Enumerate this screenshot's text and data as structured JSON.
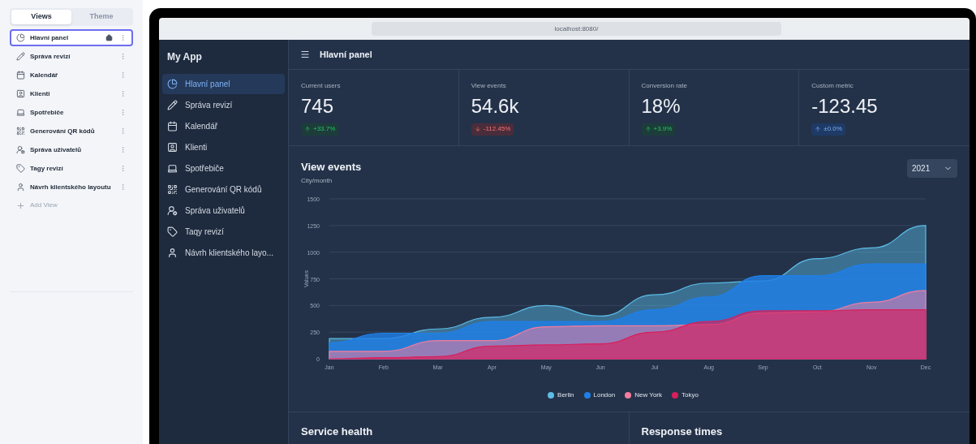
{
  "editor_panel": {
    "tabs": [
      {
        "label": "Views",
        "selected": true
      },
      {
        "label": "Theme",
        "selected": false
      }
    ],
    "views": [
      {
        "label": "Hlavní panel",
        "selected": true,
        "home": true
      },
      {
        "label": "Správa revizí",
        "selected": false,
        "home": false
      },
      {
        "label": "Kalendář",
        "selected": false,
        "home": false
      },
      {
        "label": "Klienti",
        "selected": false,
        "home": false
      },
      {
        "label": "Spotřebiče",
        "selected": false,
        "home": false
      },
      {
        "label": "Generování QR kódů",
        "selected": false,
        "home": false
      },
      {
        "label": "Správa uživatelů",
        "selected": false,
        "home": false
      },
      {
        "label": "Tagy revizí",
        "selected": false,
        "home": false
      },
      {
        "label": "Návrh klientského layoutu",
        "selected": false,
        "home": false
      }
    ],
    "add_view": "Add View"
  },
  "browser": {
    "url": "localhost:8080/"
  },
  "app": {
    "title": "My App",
    "nav": [
      {
        "label": "Hlavní panel",
        "selected": true
      },
      {
        "label": "Správa revizí",
        "selected": false
      },
      {
        "label": "Kalendář",
        "selected": false
      },
      {
        "label": "Klienti",
        "selected": false
      },
      {
        "label": "Spotřebiče",
        "selected": false
      },
      {
        "label": "Generování QR kódů",
        "selected": false
      },
      {
        "label": "Správa uživatelů",
        "selected": false
      },
      {
        "label": "Taqy revizí",
        "selected": false
      },
      {
        "label": "Návrh klientského layo...",
        "selected": false
      }
    ],
    "header_title": "Hlavní panel",
    "metrics": [
      {
        "label": "Current users",
        "value": "745",
        "change": "+33.7%",
        "kind": "up"
      },
      {
        "label": "View events",
        "value": "54.6k",
        "change": "-112.45%",
        "kind": "down"
      },
      {
        "label": "Conversion rate",
        "value": "18%",
        "change": "+3.9%",
        "kind": "up"
      },
      {
        "label": "Custom metric",
        "value": "-123.45",
        "change": "±0.0%",
        "kind": "neutral"
      }
    ],
    "chart_panel": {
      "title": "View events",
      "subtitle": "City/month",
      "year_select": "2021",
      "chart_data": {
        "type": "area",
        "ylabel": "Values",
        "categories": [
          "Jan",
          "Feb",
          "Mar",
          "Apr",
          "May",
          "Jun",
          "Jul",
          "Aug",
          "Sep",
          "Oct",
          "Nov",
          "Dec"
        ],
        "ylim": [
          0,
          1500
        ],
        "yticks": [
          0,
          250,
          500,
          750,
          1000,
          1250,
          1500
        ],
        "grid": true,
        "legend": "bottom",
        "series": [
          {
            "name": "Berlin",
            "color": "#5bbde8",
            "values": [
              190,
              190,
              280,
              390,
              500,
              400,
              600,
              710,
              730,
              940,
              1040,
              1250
            ]
          },
          {
            "name": "London",
            "color": "#1f7fe8",
            "values": [
              150,
              240,
              240,
              350,
              350,
              350,
              460,
              580,
              780,
              780,
              890,
              890
            ]
          },
          {
            "name": "New York",
            "color": "#f47c9c",
            "values": [
              70,
              70,
              170,
              170,
              300,
              310,
              310,
              320,
              430,
              440,
              530,
              640
            ]
          },
          {
            "name": "Tokyo",
            "color": "#d81f5c",
            "values": [
              0,
              10,
              20,
              120,
              130,
              140,
              250,
              350,
              450,
              450,
              460,
              460
            ]
          }
        ]
      }
    },
    "panels": [
      {
        "title": "Service health"
      },
      {
        "title": "Response times"
      }
    ]
  }
}
